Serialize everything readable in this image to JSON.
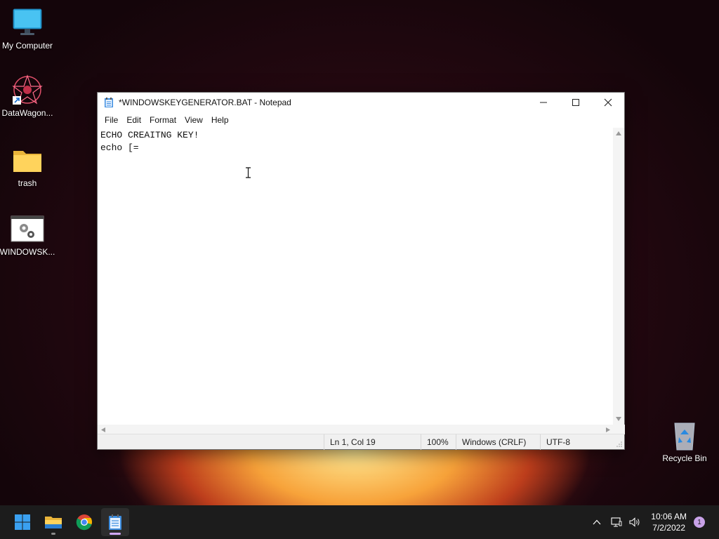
{
  "desktop": {
    "icons": [
      {
        "label": "My Computer",
        "icon": "monitor-icon"
      },
      {
        "label": "DataWagon...",
        "icon": "datawagon-icon"
      },
      {
        "label": "trash",
        "icon": "folder-icon"
      },
      {
        "label": "WINDOWSK...",
        "icon": "batch-file-icon"
      }
    ],
    "recycle_bin": {
      "label": "Recycle Bin",
      "icon": "recycle-bin-icon"
    }
  },
  "notepad": {
    "title": "*WINDOWSKEYGENERATOR.BAT - Notepad",
    "menu": [
      "File",
      "Edit",
      "Format",
      "View",
      "Help"
    ],
    "content": "ECHO CREAITNG KEY!\necho [=",
    "status": {
      "position": "Ln 1, Col 19",
      "zoom": "100%",
      "line_ending": "Windows (CRLF)",
      "encoding": "UTF-8"
    }
  },
  "taskbar": {
    "apps": [
      "start-icon",
      "file-explorer-icon",
      "chrome-icon",
      "notepad-icon"
    ],
    "clock": {
      "time": "10:06 AM",
      "date": "7/2/2022"
    },
    "notification_count": "1"
  },
  "colors": {
    "accent": "#0078d4",
    "taskbar": "#1c1c1c",
    "active_indicator": "#d2a8ff"
  }
}
